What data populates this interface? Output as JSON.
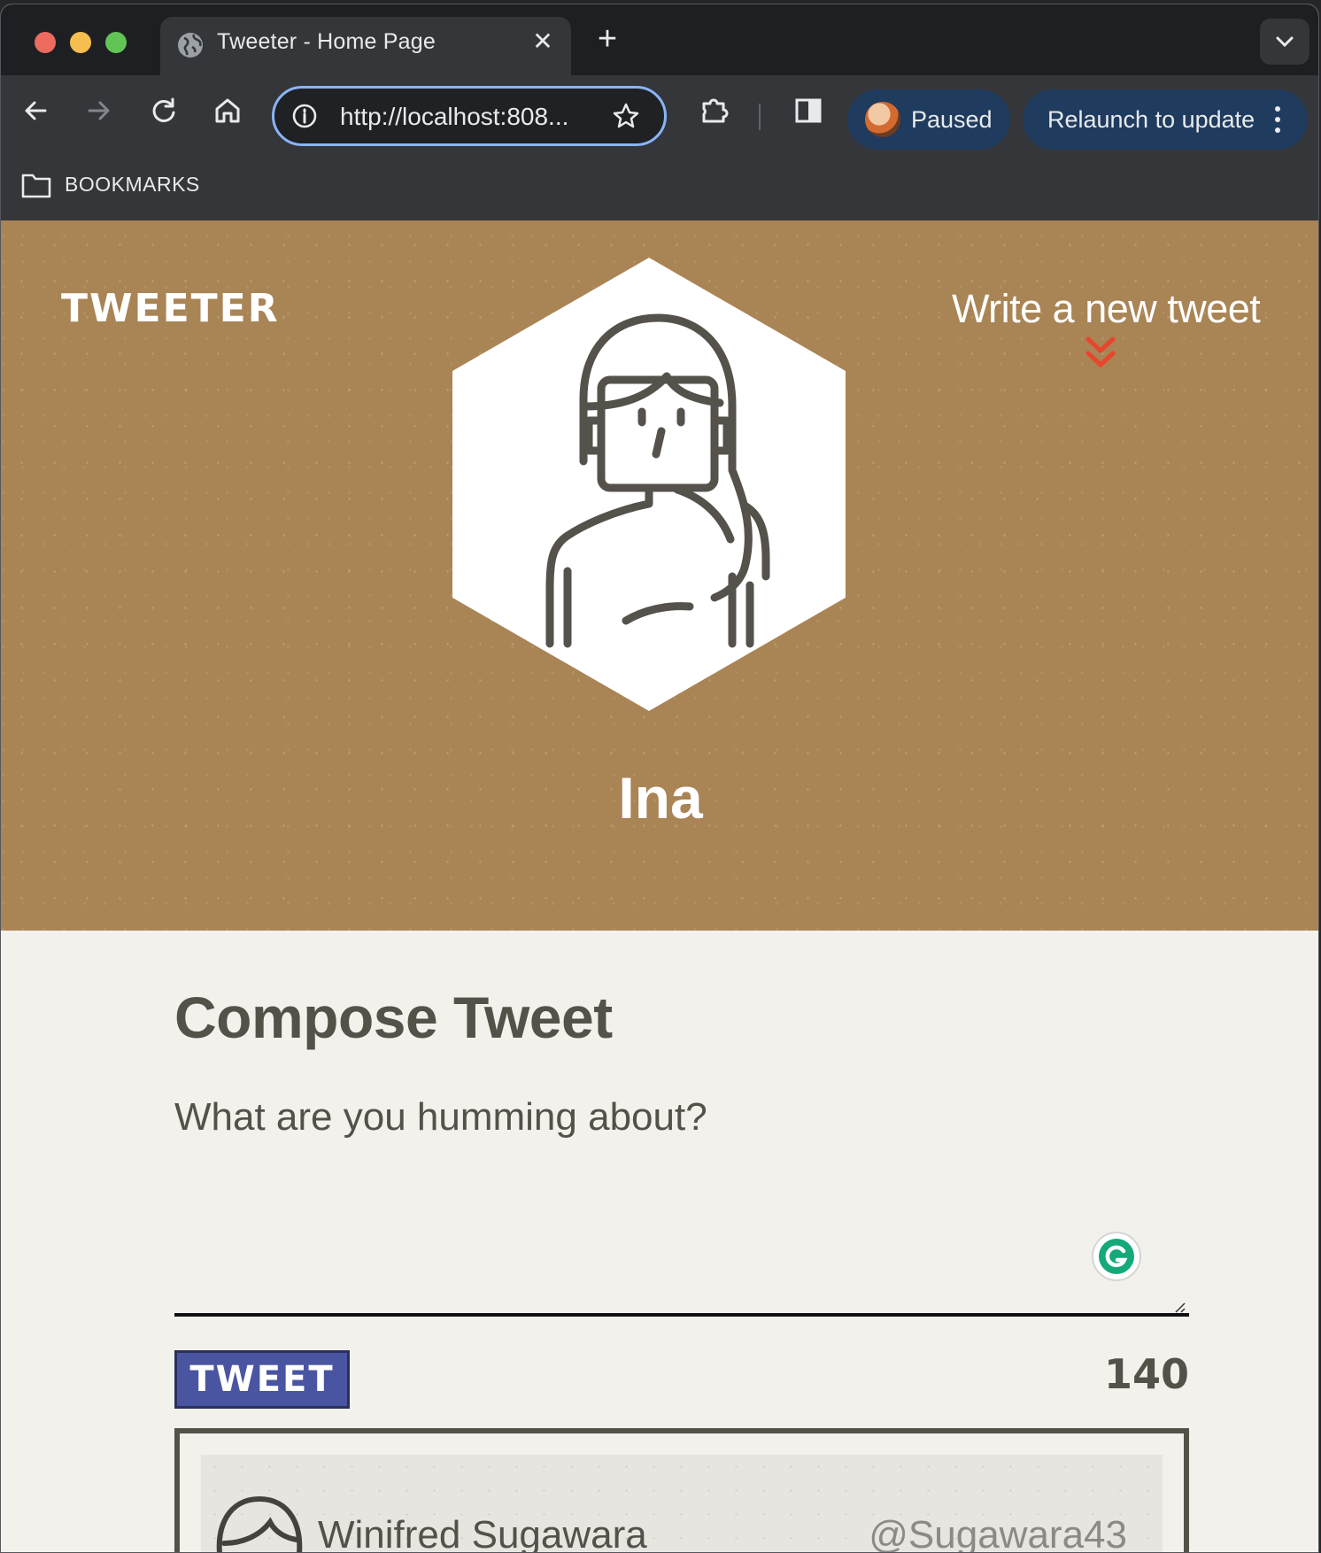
{
  "browser": {
    "tab_title": "Tweeter - Home Page",
    "url": "http://localhost:808...",
    "profile_status": "Paused",
    "relaunch_label": "Relaunch to update",
    "bookmarks_label": "BOOKMARKS"
  },
  "header": {
    "brand": "TWEETER",
    "write_link": "Write a new tweet",
    "user_name": "Ina",
    "accent_color": "#e8452c",
    "background_color": "#a98455"
  },
  "compose": {
    "title": "Compose Tweet",
    "placeholder": "What are you humming about?",
    "tweet_button": "TWEET",
    "char_counter": "140",
    "button_color": "#4a55a2"
  },
  "feed": {
    "tweets": [
      {
        "name": "Winifred Sugawara",
        "handle": "@Sugawara43"
      }
    ]
  },
  "icons": [
    "globe-icon",
    "close-icon",
    "plus-icon",
    "chevron-down-icon",
    "back-icon",
    "forward-icon",
    "reload-icon",
    "home-icon",
    "info-icon",
    "star-icon",
    "extensions-icon",
    "side-panel-icon",
    "kebab-menu-icon",
    "folder-icon",
    "double-chevron-down-icon",
    "grammarly-icon"
  ]
}
